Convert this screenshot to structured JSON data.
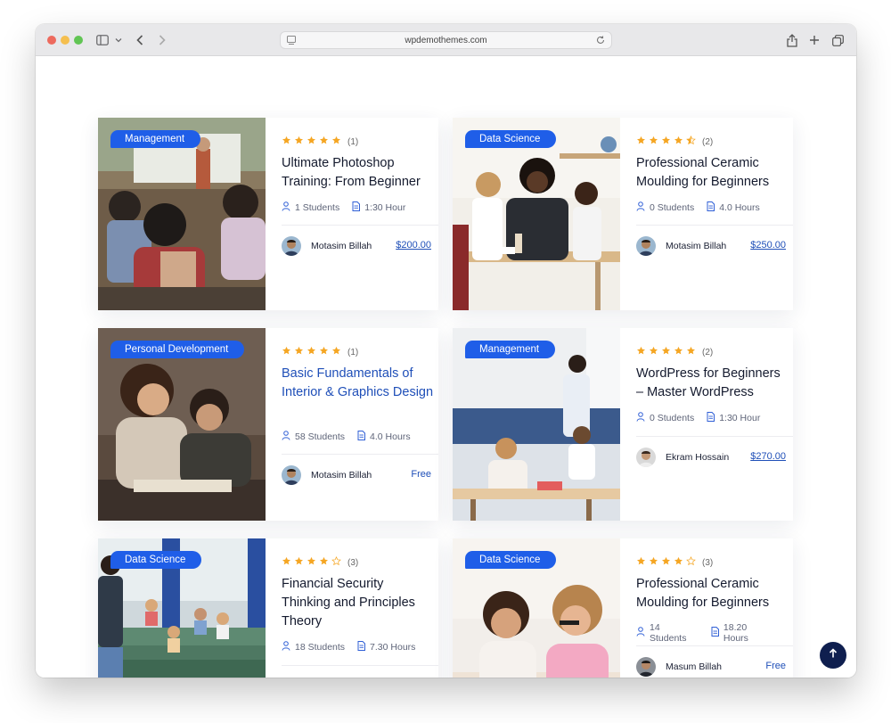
{
  "browser": {
    "url": "wpdemothemes.com",
    "traffic_lights": [
      "#ed6a5e",
      "#f5bf4f",
      "#61c554"
    ]
  },
  "accent": "#1f5ee8",
  "star_color": "#f5a623",
  "courses": [
    {
      "category": "Management",
      "rating": 5,
      "review_count": "(1)",
      "title": "Ultimate Photoshop Training: From Beginner",
      "students": "1 Students",
      "duration": "1:30 Hour",
      "instructor": "Motasim Billah",
      "price": "$200.00"
    },
    {
      "category": "Data Science",
      "rating": 4.5,
      "review_count": "(2)",
      "title": "Professional Ceramic Moulding for Beginners",
      "students": "0 Students",
      "duration": "4.0 Hours",
      "instructor": "Motasim Billah",
      "price": "$250.00"
    },
    {
      "category": "Personal Development",
      "rating": 5,
      "review_count": "(1)",
      "title": "Basic Fundamentals of Interior & Graphics Design",
      "students": "58 Students",
      "duration": "4.0 Hours",
      "instructor": "Motasim Billah",
      "price": "Free"
    },
    {
      "category": "Management",
      "rating": 5,
      "review_count": "(2)",
      "title": "WordPress for Beginners – Master WordPress",
      "students": "0 Students",
      "duration": "1:30 Hour",
      "instructor": "Ekram Hossain",
      "price": "$270.00"
    },
    {
      "category": "Data Science",
      "rating": 4,
      "review_count": "(3)",
      "title": "Financial Security Thinking and Principles Theory",
      "students": "18 Students",
      "duration": "7.30 Hours",
      "instructor": "",
      "price": ""
    },
    {
      "category": "Data Science",
      "rating": 4,
      "review_count": "(3)",
      "title": "Professional Ceramic Moulding for Beginners",
      "students": "14 Students",
      "duration": "18.20 Hours",
      "instructor": "Masum Billah",
      "price": "Free"
    }
  ]
}
